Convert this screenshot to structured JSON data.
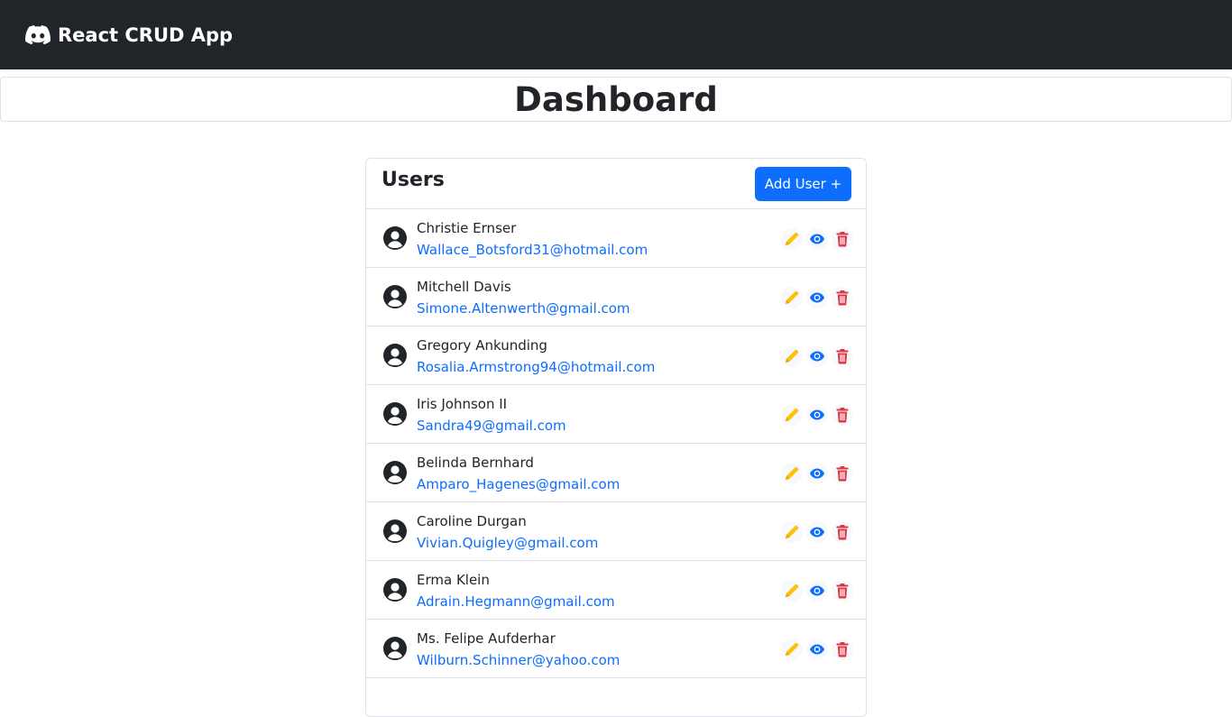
{
  "navbar": {
    "brand_label": "React CRUD App",
    "brand_icon": "discord-icon"
  },
  "page": {
    "title": "Dashboard"
  },
  "users_card": {
    "title": "Users",
    "add_button_label": "Add User +",
    "users": [
      {
        "name": "Christie Ernser",
        "email": "Wallace_Botsford31@hotmail.com"
      },
      {
        "name": "Mitchell Davis",
        "email": "Simone.Altenwerth@gmail.com"
      },
      {
        "name": "Gregory Ankunding",
        "email": "Rosalia.Armstrong94@hotmail.com"
      },
      {
        "name": "Iris Johnson II",
        "email": "Sandra49@gmail.com"
      },
      {
        "name": "Belinda Bernhard",
        "email": "Amparo_Hagenes@gmail.com"
      },
      {
        "name": "Caroline Durgan",
        "email": "Vivian.Quigley@gmail.com"
      },
      {
        "name": "Erma Klein",
        "email": "Adrain.Hegmann@gmail.com"
      },
      {
        "name": "Ms. Felipe Aufderhar",
        "email": "Wilburn.Schinner@yahoo.com"
      }
    ]
  },
  "colors": {
    "navbar": "#212529",
    "primary": "#0d6efd",
    "edit": "#ffc107",
    "delete": "#dc3545"
  },
  "icons": {
    "avatar": "user-circle-icon",
    "edit": "pencil-icon",
    "view": "eye-icon",
    "delete": "trash-icon"
  }
}
